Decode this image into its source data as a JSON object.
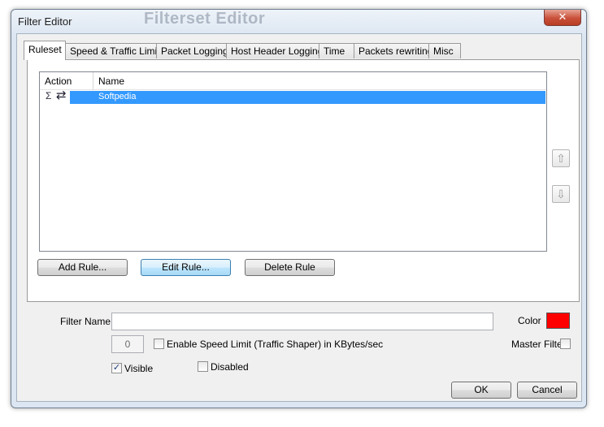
{
  "window": {
    "title": "Filter Editor",
    "ghost_title": "Filterset Editor",
    "close_symbol": "✕"
  },
  "tabs": [
    {
      "label": "Ruleset",
      "active": true
    },
    {
      "label": "Speed & Traffic Limit",
      "active": false
    },
    {
      "label": "Packet Logging",
      "active": false
    },
    {
      "label": "Host Header Logging",
      "active": false
    },
    {
      "label": "Time",
      "active": false
    },
    {
      "label": "Packets rewriting",
      "active": false
    },
    {
      "label": "Misc",
      "active": false
    }
  ],
  "rules_table": {
    "columns": [
      "Action",
      "Name"
    ],
    "rows": [
      {
        "action_icons": [
          "sigma-icon",
          "swap-arrows-icon"
        ],
        "sigma_glyph": "Σ",
        "swap_glyph": "⇄",
        "name": "Softpedia",
        "selected": true
      }
    ]
  },
  "side_buttons": {
    "up_glyph": "⇧",
    "down_glyph": "⇩"
  },
  "rule_buttons": {
    "add": "Add Rule...",
    "edit": "Edit Rule...",
    "delete": "Delete Rule"
  },
  "filter_name": {
    "label": "Filter Name",
    "value": ""
  },
  "color": {
    "label": "Color",
    "value": "#ff0000"
  },
  "speed_limit": {
    "value": "0",
    "label": "Enable Speed Limit (Traffic Shaper) in KBytes/sec",
    "checked": false
  },
  "master_filter": {
    "label": "Master Filter",
    "checked": false
  },
  "visible": {
    "label": "Visible",
    "checked": true
  },
  "disabled": {
    "label": "Disabled",
    "checked": false
  },
  "dialog_buttons": {
    "ok": "OK",
    "cancel": "Cancel"
  }
}
